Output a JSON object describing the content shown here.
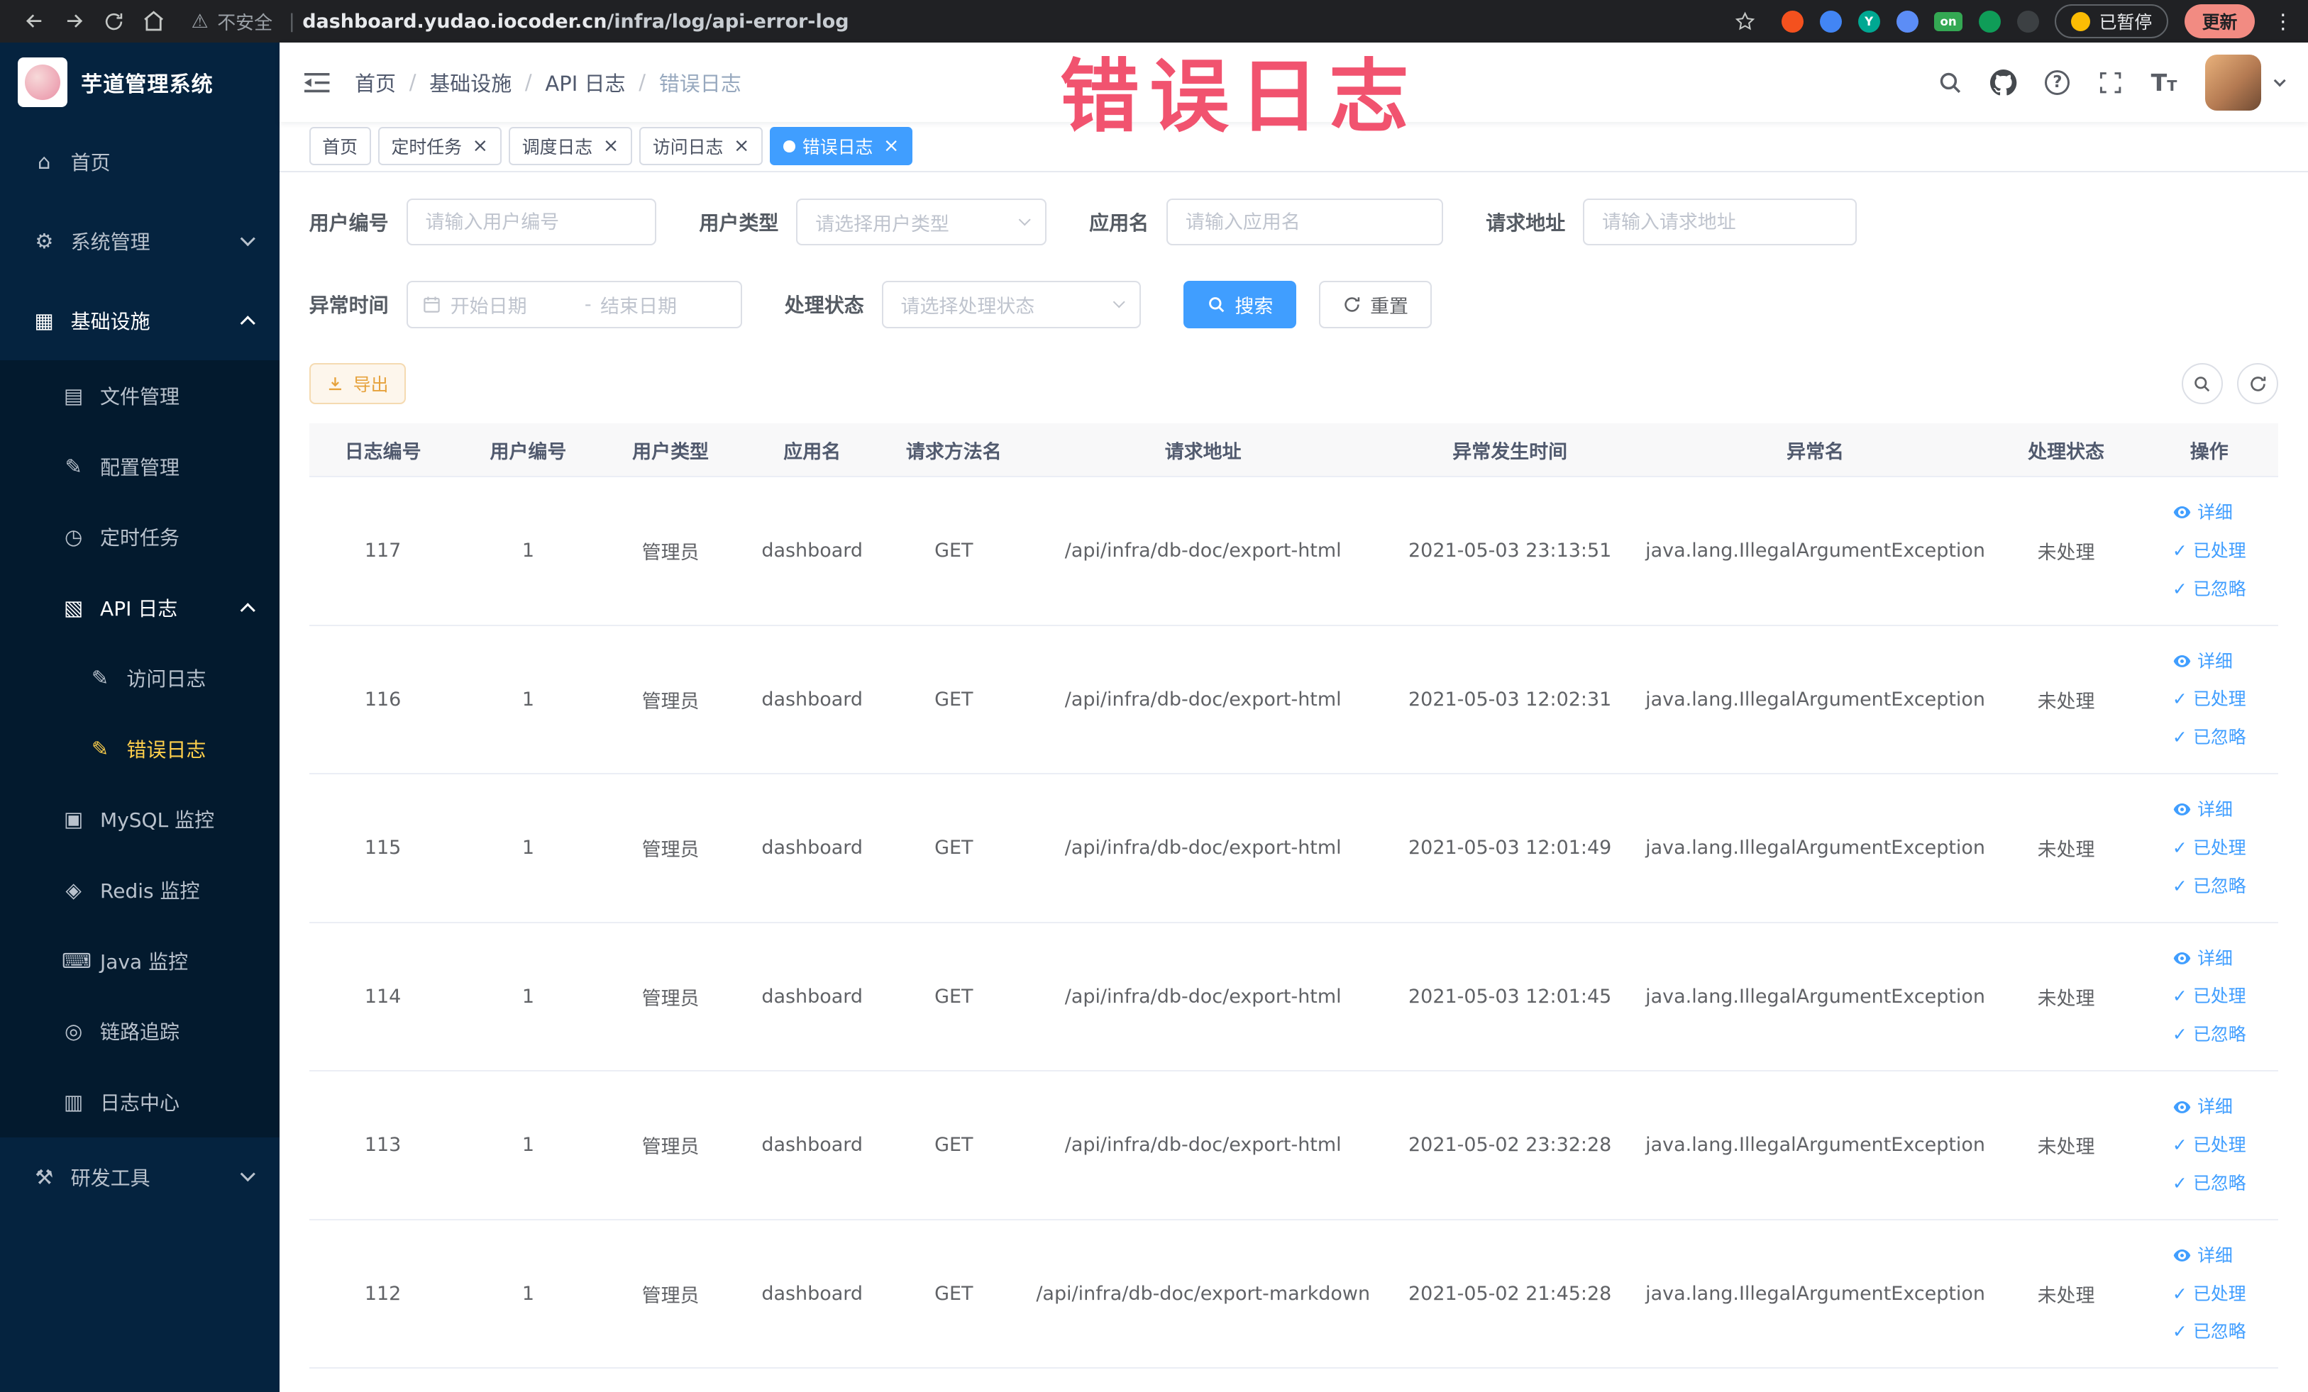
{
  "colors": {
    "accent": "#409eff",
    "menu_active_text": "#ffd04b",
    "sidebar_bg": "#05233f",
    "watermark": "#f1536f",
    "warning": "#e6a23c"
  },
  "browser": {
    "security_label": "不安全",
    "url_domain": "dashboard.yudao.iocoder.cn",
    "url_path": "/infra/log/api-error-log",
    "extension_on_label": "on",
    "paused_label": "已暂停",
    "update_label": "更新"
  },
  "sidebar": {
    "app_title": "芋道管理系统",
    "items": [
      {
        "key": "home",
        "label": "首页",
        "icon": "home",
        "level": 0
      },
      {
        "key": "system-mgmt",
        "label": "系统管理",
        "icon": "gear",
        "level": 0,
        "chevron": "down"
      },
      {
        "key": "infrastructure",
        "label": "基础设施",
        "icon": "grid",
        "level": 0,
        "chevron": "up",
        "open": true
      },
      {
        "key": "file-mgmt",
        "label": "文件管理",
        "icon": "file",
        "level": 1
      },
      {
        "key": "config-mgmt",
        "label": "配置管理",
        "icon": "edit",
        "level": 1
      },
      {
        "key": "scheduled-tasks",
        "label": "定时任务",
        "icon": "clock",
        "level": 1
      },
      {
        "key": "api-log",
        "label": "API 日志",
        "icon": "log",
        "level": 1,
        "chevron": "up",
        "open": true
      },
      {
        "key": "access-log",
        "label": "访问日志",
        "icon": "doc",
        "level": 2
      },
      {
        "key": "error-log",
        "label": "错误日志",
        "icon": "doc",
        "level": 2,
        "active": true
      },
      {
        "key": "mysql-monitor",
        "label": "MySQL 监控",
        "icon": "db",
        "level": 1
      },
      {
        "key": "redis-monitor",
        "label": "Redis 监控",
        "icon": "redis",
        "level": 1
      },
      {
        "key": "java-monitor",
        "label": "Java 监控",
        "icon": "java",
        "level": 1
      },
      {
        "key": "trace",
        "label": "链路追踪",
        "icon": "trace",
        "level": 1
      },
      {
        "key": "log-center",
        "label": "日志中心",
        "icon": "center",
        "level": 1
      },
      {
        "key": "dev-tools",
        "label": "研发工具",
        "icon": "tools",
        "level": 0,
        "chevron": "down"
      }
    ]
  },
  "header": {
    "breadcrumbs": [
      "首页",
      "基础设施",
      "API 日志",
      "错误日志"
    ]
  },
  "watermark": "错误日志",
  "tabs": [
    {
      "key": "home",
      "label": "首页"
    },
    {
      "key": "scheduled-tasks",
      "label": "定时任务",
      "closable": true
    },
    {
      "key": "schedule-log",
      "label": "调度日志",
      "closable": true
    },
    {
      "key": "access-log",
      "label": "访问日志",
      "closable": true
    },
    {
      "key": "error-log",
      "label": "错误日志",
      "closable": true,
      "active": true
    }
  ],
  "filters": {
    "user_id": {
      "label": "用户编号",
      "placeholder": "请输入用户编号"
    },
    "user_type": {
      "label": "用户类型",
      "placeholder": "请选择用户类型"
    },
    "app_name": {
      "label": "应用名",
      "placeholder": "请输入应用名"
    },
    "request_url": {
      "label": "请求地址",
      "placeholder": "请输入请求地址"
    },
    "exception_time": {
      "label": "异常时间",
      "start_placeholder": "开始日期",
      "separator": "-",
      "end_placeholder": "结束日期"
    },
    "process_status": {
      "label": "处理状态",
      "placeholder": "请选择处理状态"
    },
    "search_label": "搜索",
    "reset_label": "重置"
  },
  "toolbar": {
    "export_label": "导出"
  },
  "table": {
    "columns": [
      "日志编号",
      "用户编号",
      "用户类型",
      "应用名",
      "请求方法名",
      "请求地址",
      "异常发生时间",
      "异常名",
      "处理状态",
      "操作"
    ],
    "row_actions": [
      "详细",
      "已处理",
      "已忽略"
    ],
    "rows": [
      [
        "117",
        "1",
        "管理员",
        "dashboard",
        "GET",
        "/api/infra/db-doc/export-html",
        "2021-05-03 23:13:51",
        "java.lang.IllegalArgumentException",
        "未处理"
      ],
      [
        "116",
        "1",
        "管理员",
        "dashboard",
        "GET",
        "/api/infra/db-doc/export-html",
        "2021-05-03 12:02:31",
        "java.lang.IllegalArgumentException",
        "未处理"
      ],
      [
        "115",
        "1",
        "管理员",
        "dashboard",
        "GET",
        "/api/infra/db-doc/export-html",
        "2021-05-03 12:01:49",
        "java.lang.IllegalArgumentException",
        "未处理"
      ],
      [
        "114",
        "1",
        "管理员",
        "dashboard",
        "GET",
        "/api/infra/db-doc/export-html",
        "2021-05-03 12:01:45",
        "java.lang.IllegalArgumentException",
        "未处理"
      ],
      [
        "113",
        "1",
        "管理员",
        "dashboard",
        "GET",
        "/api/infra/db-doc/export-html",
        "2021-05-02 23:32:28",
        "java.lang.IllegalArgumentException",
        "未处理"
      ],
      [
        "112",
        "1",
        "管理员",
        "dashboard",
        "GET",
        "/api/infra/db-doc/export-markdown",
        "2021-05-02 21:45:28",
        "java.lang.IllegalArgumentException",
        "未处理"
      ]
    ]
  }
}
